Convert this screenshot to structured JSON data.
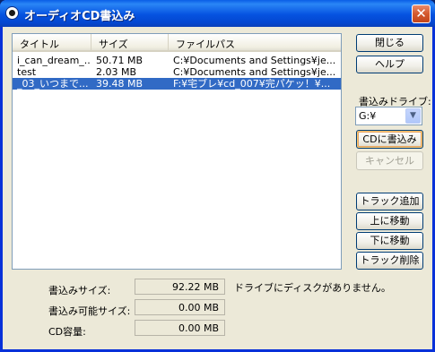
{
  "window": {
    "title": "オーディオCD書込み",
    "close_glyph": "✕"
  },
  "list": {
    "columns": [
      "タイトル",
      "サイズ",
      "ファイルパス"
    ],
    "rows": [
      {
        "title": "i_can_dream_...",
        "size": "50.71 MB",
        "path": "C:¥Documents and Settings¥je...",
        "selected": false
      },
      {
        "title": "test",
        "size": "2.03 MB",
        "path": "C:¥Documents and Settings¥je...",
        "selected": false
      },
      {
        "title": "_03_いつまで...",
        "size": "39.48 MB",
        "path": "F:¥宅ブレ¥cd_007¥完パケッ！¥...",
        "selected": true
      }
    ]
  },
  "buttons": {
    "close": "閉じる",
    "help": "ヘルプ",
    "write_cd": "CDに書込み",
    "cancel": "キャンセル",
    "add_track": "トラック追加",
    "move_up": "上に移動",
    "move_down": "下に移動",
    "delete_track": "トラック削除"
  },
  "drive": {
    "label": "書込みドライブ:",
    "selected": "G:¥"
  },
  "stats": {
    "write_size_label": "書込みサイズ:",
    "write_size_value": "92.22 MB",
    "writable_size_label": "書込み可能サイズ:",
    "writable_size_value": "0.00 MB",
    "cd_capacity_label": "CD容量:",
    "cd_capacity_value": "0.00 MB"
  },
  "status_message": "ドライブにディスクがありません。",
  "colors": {
    "title_bar": "#0552e0",
    "selection": "#316ac5",
    "dialog_bg": "#ece9d8"
  }
}
